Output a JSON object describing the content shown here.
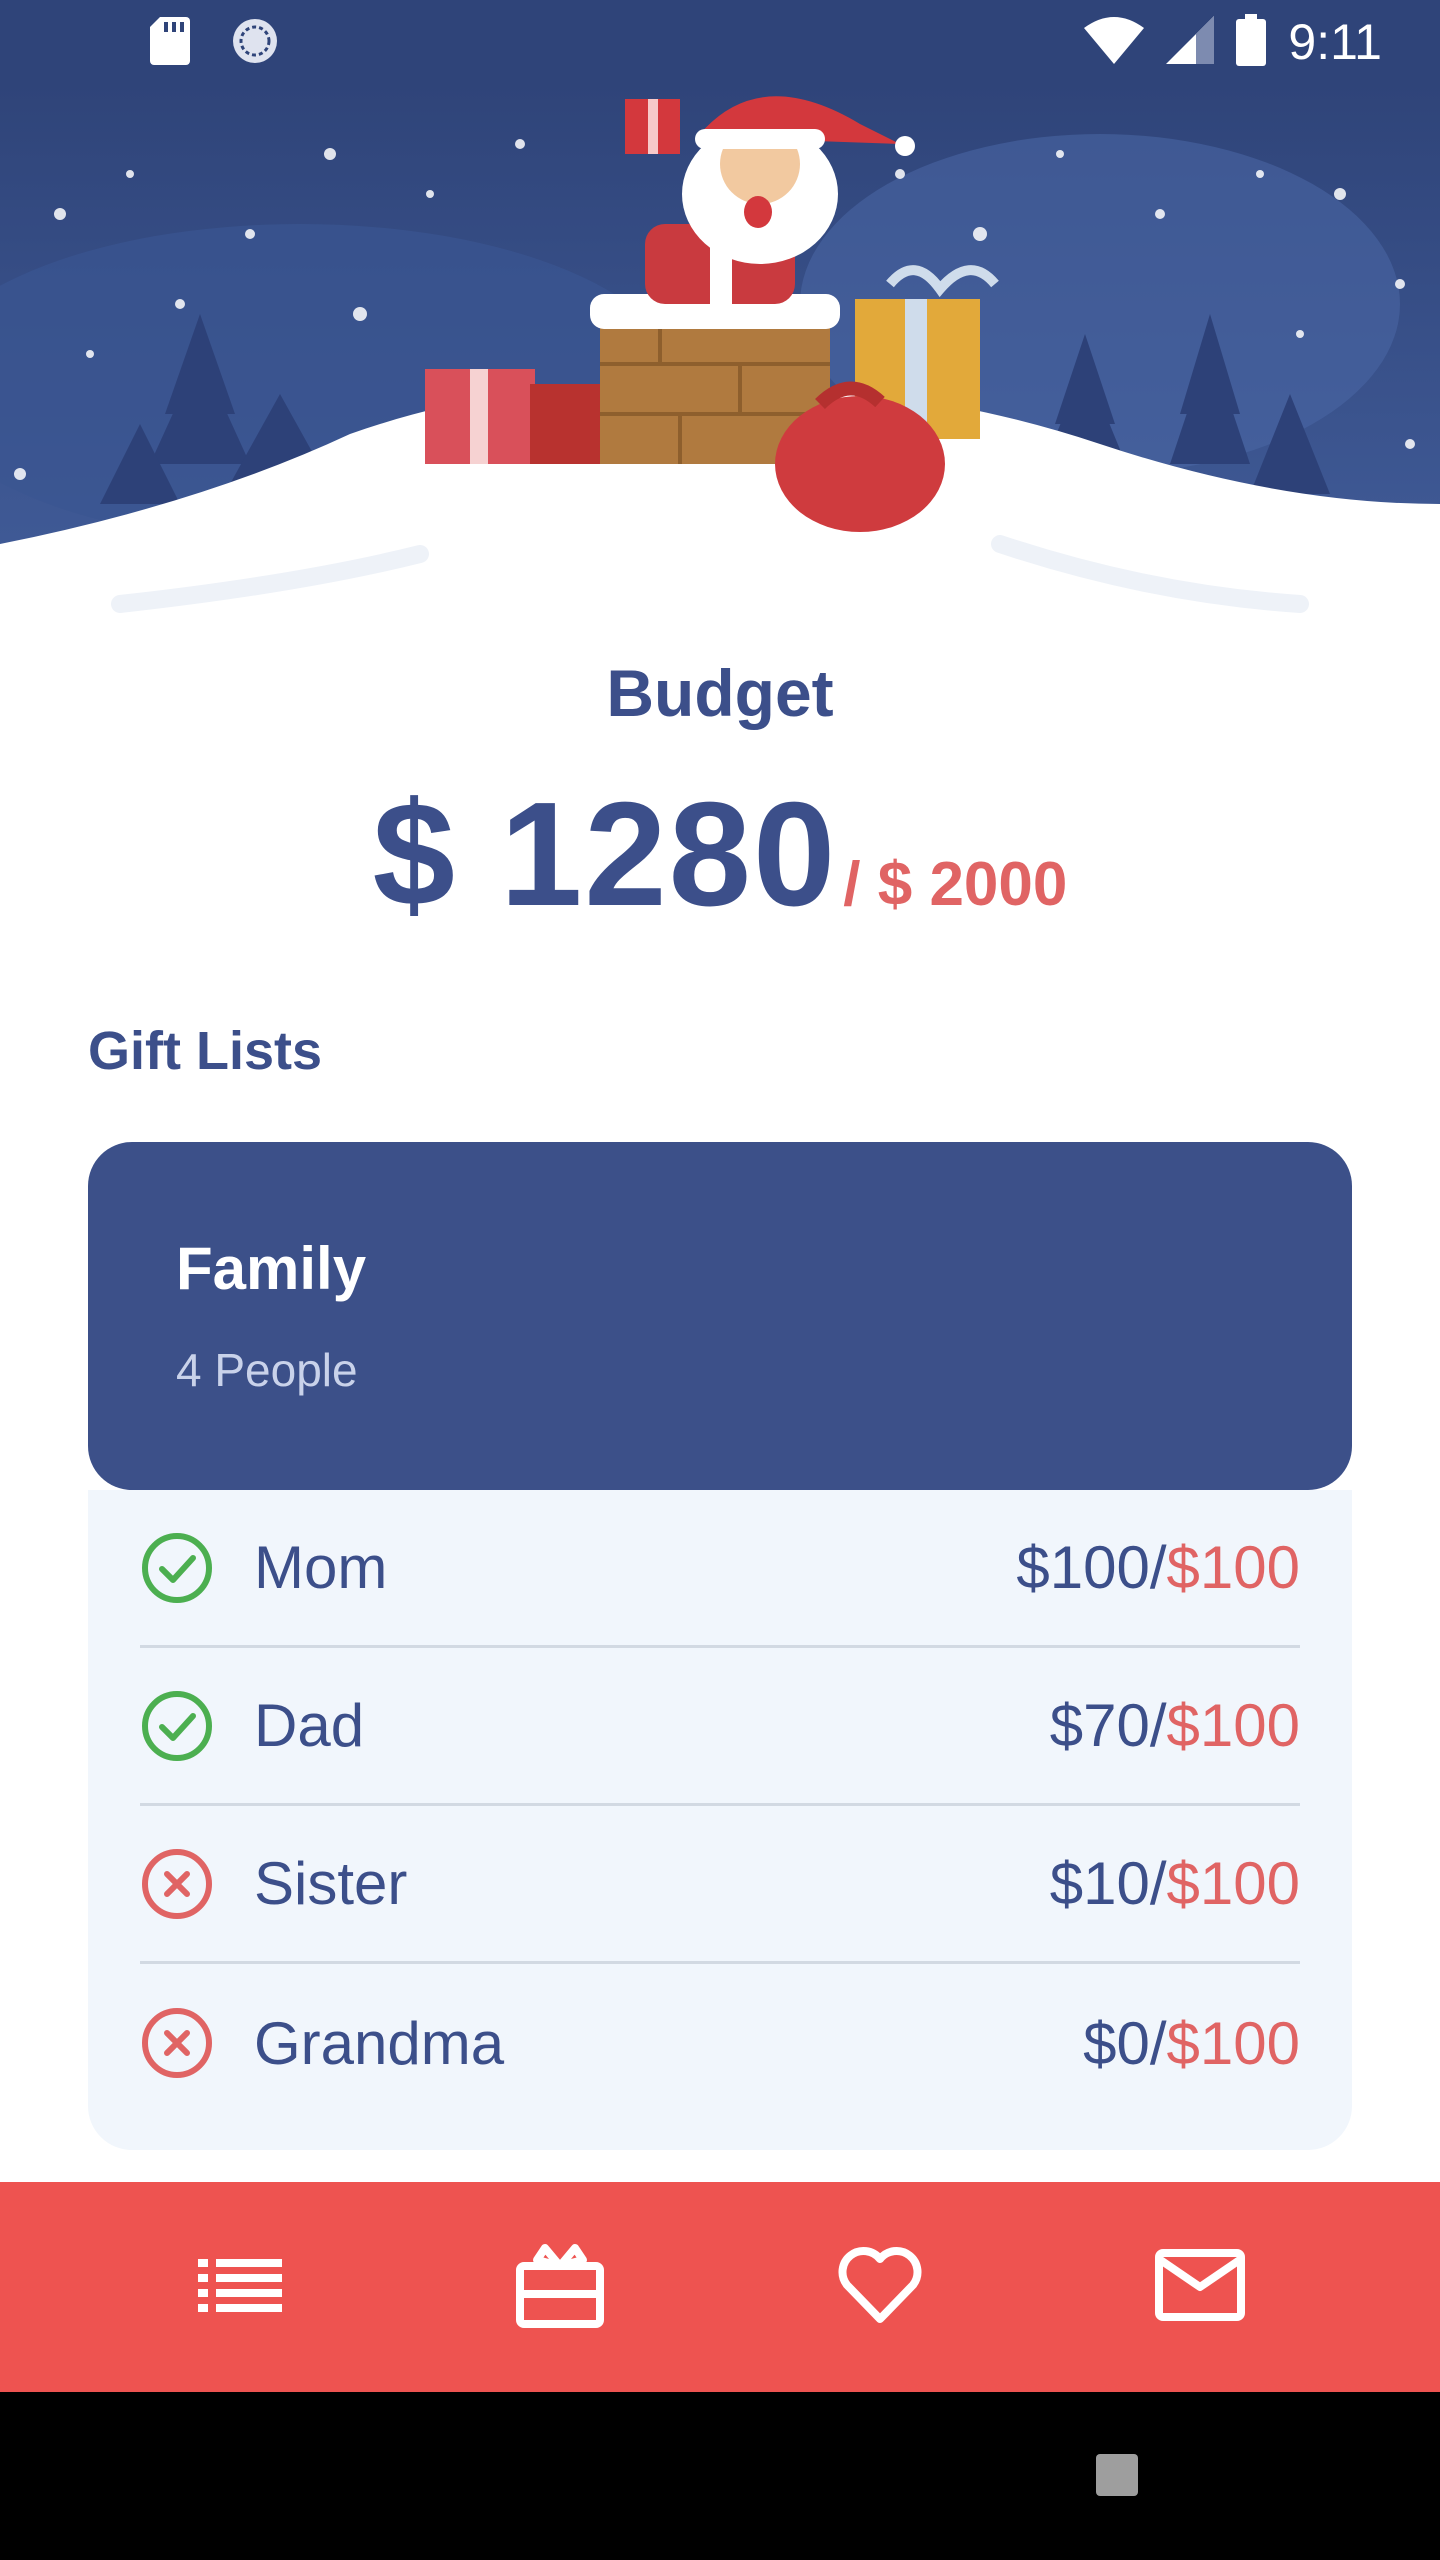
{
  "status_bar": {
    "time": "9:11",
    "left_icons": [
      "sd-card-icon",
      "sync-icon"
    ],
    "right_icons": [
      "wifi-icon",
      "signal-icon",
      "battery-icon"
    ]
  },
  "hero": {
    "illustration": "santa-chimney-gifts-illustration"
  },
  "budget": {
    "title": "Budget",
    "spent": "$ 1280",
    "total": "/ $ 2000"
  },
  "gift_lists": {
    "section_title": "Gift Lists",
    "card": {
      "title": "Family",
      "subtitle": "4 People",
      "members": [
        {
          "name": "Mom",
          "amount": "$100/",
          "limit": "$100",
          "status": "complete"
        },
        {
          "name": "Dad",
          "amount": "$70/",
          "limit": "$100",
          "status": "complete"
        },
        {
          "name": "Sister",
          "amount": "$10/",
          "limit": "$100",
          "status": "incomplete"
        },
        {
          "name": "Grandma",
          "amount": "$0/",
          "limit": "$100",
          "status": "incomplete"
        }
      ]
    }
  },
  "bottom_nav": {
    "items": [
      "list-icon",
      "gift-icon",
      "heart-icon",
      "mail-icon"
    ]
  },
  "colors": {
    "primary": "#3c5089",
    "accent": "#ee5350",
    "success": "#4caf50",
    "danger": "#e06464",
    "card_body": "#f1f6fc"
  }
}
